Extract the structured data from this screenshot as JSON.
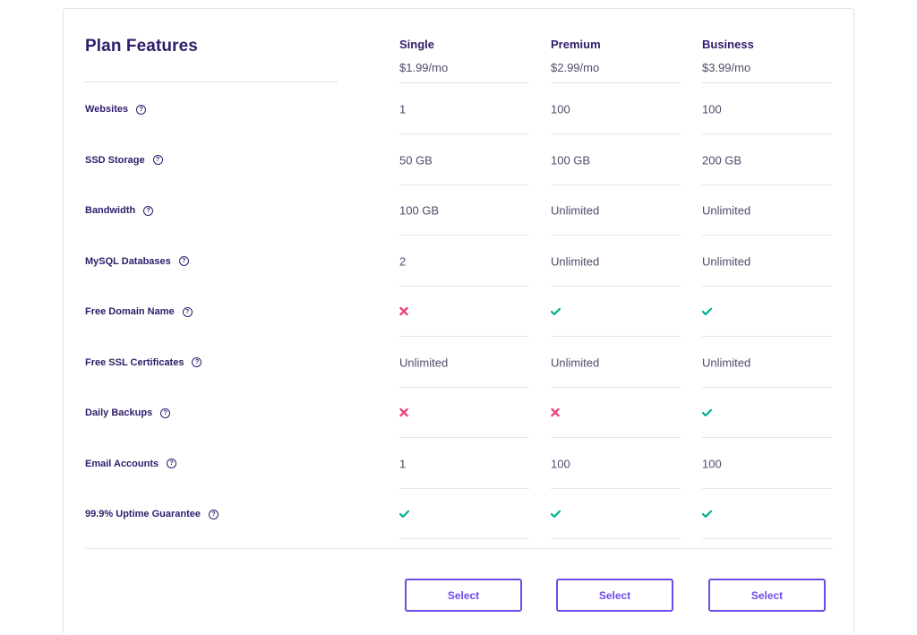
{
  "title": "Plan Features",
  "plans": [
    {
      "name": "Single",
      "price": "$1.99/mo"
    },
    {
      "name": "Premium",
      "price": "$2.99/mo"
    },
    {
      "name": "Business",
      "price": "$3.99/mo"
    }
  ],
  "features": [
    {
      "label": "Websites",
      "values": [
        "1",
        "100",
        "100"
      ]
    },
    {
      "label": "SSD Storage",
      "values": [
        "50 GB",
        "100 GB",
        "200 GB"
      ]
    },
    {
      "label": "Bandwidth",
      "values": [
        "100 GB",
        "Unlimited",
        "Unlimited"
      ]
    },
    {
      "label": "MySQL Databases",
      "values": [
        "2",
        "Unlimited",
        "Unlimited"
      ]
    },
    {
      "label": "Free Domain Name",
      "values": [
        "no",
        "yes",
        "yes"
      ]
    },
    {
      "label": "Free SSL Certificates",
      "values": [
        "Unlimited",
        "Unlimited",
        "Unlimited"
      ]
    },
    {
      "label": "Daily Backups",
      "values": [
        "no",
        "no",
        "yes"
      ]
    },
    {
      "label": "Email Accounts",
      "values": [
        "1",
        "100",
        "100"
      ]
    },
    {
      "label": "99.9% Uptime Guarantee",
      "values": [
        "yes",
        "yes",
        "yes"
      ]
    }
  ],
  "select_label": "Select",
  "icons": {
    "yes": "check-icon",
    "no": "cross-icon",
    "help": "question-circle-icon"
  },
  "colors": {
    "accent": "#6f4ae8",
    "heading": "#2f1c6a",
    "check": "#00b090",
    "cross": "#e8467c"
  }
}
